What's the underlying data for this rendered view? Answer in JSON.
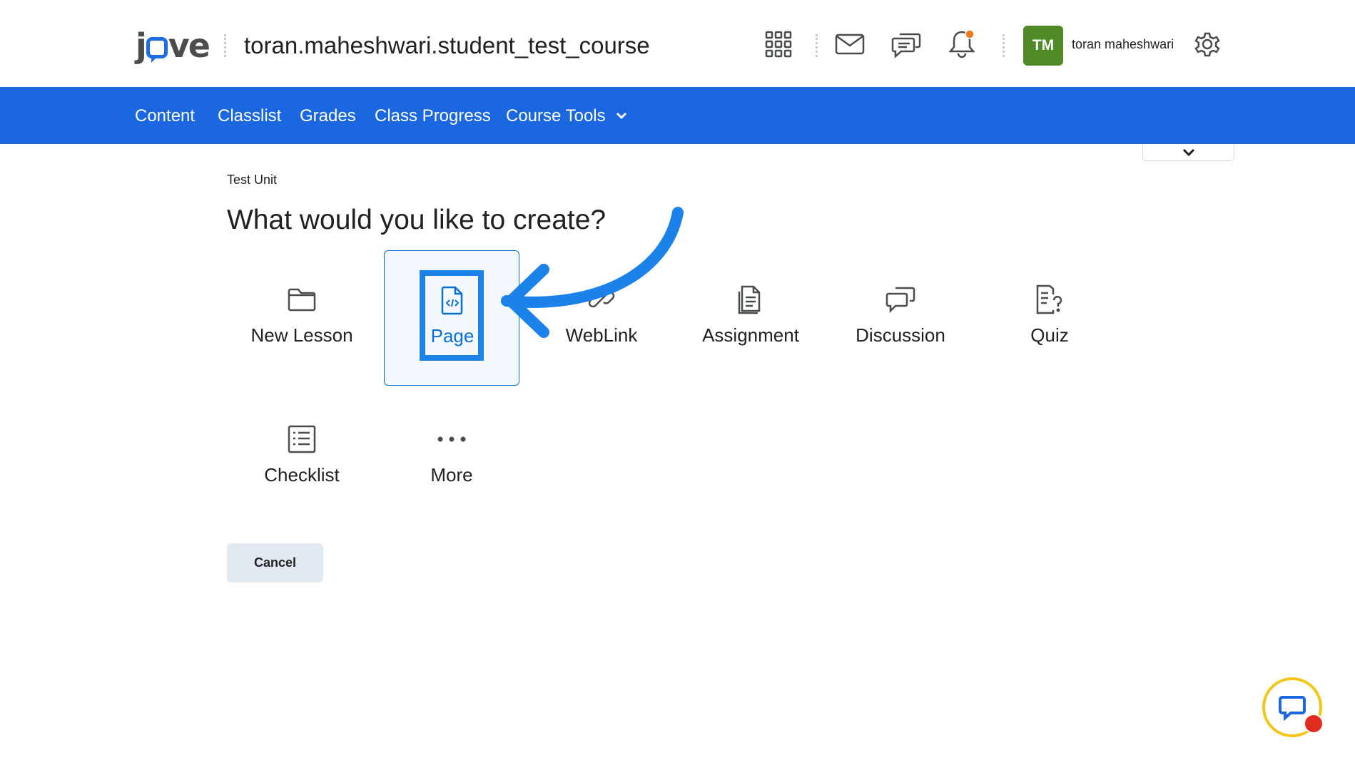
{
  "header": {
    "logo_text": "jove",
    "course_title": "toran.maheshwari.student_test_course",
    "icons": [
      "apps-grid-icon",
      "mail-icon",
      "chat-bubbles-icon",
      "bell-icon",
      "gear-icon"
    ],
    "notification_dot_color": "#f07b1e",
    "user": {
      "initials": "TM",
      "name": "toran maheshwari",
      "avatar_color": "#4f8a27"
    }
  },
  "nav": {
    "color": "#1b67df",
    "items": [
      {
        "label": "Content"
      },
      {
        "label": "Classlist"
      },
      {
        "label": "Grades"
      },
      {
        "label": "Class Progress"
      },
      {
        "label": "Course Tools"
      }
    ]
  },
  "main": {
    "breadcrumb": "Test Unit",
    "heading": "What would you like to create?",
    "options": [
      {
        "label": "New Lesson",
        "icon": "folder-icon",
        "selected": false
      },
      {
        "label": "Page",
        "icon": "code-file-icon",
        "selected": true
      },
      {
        "label": "WebLink",
        "icon": "link-icon",
        "selected": false
      },
      {
        "label": "Assignment",
        "icon": "assignment-icon",
        "selected": false
      },
      {
        "label": "Discussion",
        "icon": "discussion-icon",
        "selected": false
      },
      {
        "label": "Quiz",
        "icon": "quiz-icon",
        "selected": false
      },
      {
        "label": "Checklist",
        "icon": "checklist-icon",
        "selected": false
      },
      {
        "label": "More",
        "icon": "more-dots-icon",
        "selected": false
      }
    ],
    "cancel_label": "Cancel",
    "accent_color": "#0a70d6",
    "annotation_color": "#1b82ea"
  }
}
